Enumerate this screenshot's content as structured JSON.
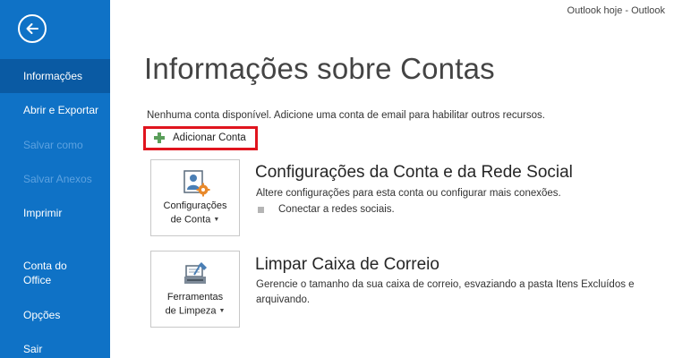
{
  "window": {
    "title": "Outlook hoje - Outlook"
  },
  "sidebar": {
    "items": [
      {
        "label": "Informações",
        "state": "active"
      },
      {
        "label": "Abrir e Exportar",
        "state": "normal"
      },
      {
        "label": "Salvar como",
        "state": "disabled"
      },
      {
        "label": "Salvar Anexos",
        "state": "disabled"
      },
      {
        "label": "Imprimir",
        "state": "normal"
      },
      {
        "label": "Conta do\nOffice",
        "state": "normal"
      },
      {
        "label": "Opções",
        "state": "normal"
      },
      {
        "label": "Sair",
        "state": "normal"
      }
    ]
  },
  "main": {
    "title": "Informações sobre Contas",
    "description": "Nenhuma conta disponível. Adicione uma conta de email para habilitar outros recursos.",
    "add_account_label": "Adicionar Conta",
    "sections": [
      {
        "tile_label_line1": "Configurações",
        "tile_label_line2": "de Conta",
        "heading": "Configurações da Conta e da Rede Social",
        "text": "Altere configurações para esta conta ou configurar mais conexões.",
        "bullet": "Conectar a redes sociais."
      },
      {
        "tile_label_line1": "Ferramentas",
        "tile_label_line2": "de Limpeza",
        "heading": "Limpar Caixa de Correio",
        "text": "Gerencie o tamanho da sua caixa de correio, esvaziando a pasta Itens Excluídos e arquivando."
      }
    ]
  },
  "colors": {
    "sidebar": "#0f72c6",
    "sidebar_active": "#0a5aa3",
    "highlight_border": "#e0141e",
    "plus_icon": "#5a9e5a"
  }
}
